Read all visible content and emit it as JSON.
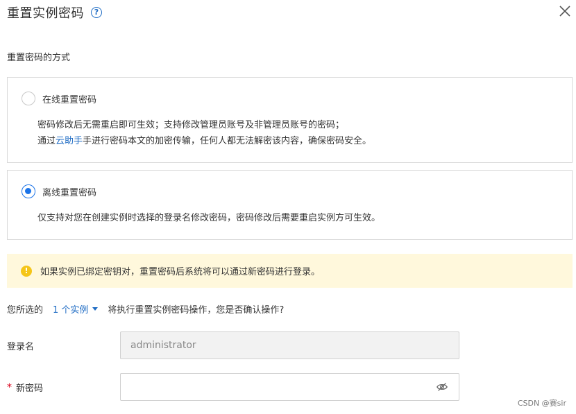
{
  "dialog": {
    "title": "重置实例密码",
    "help_icon": "question-circle-icon",
    "close_icon": "close-icon"
  },
  "method": {
    "section_label": "重置密码的方式",
    "online": {
      "label": "在线重置密码",
      "selected": false,
      "desc_line1": "密码修改后无需重启即可生效；支持修改管理员账号及非管理员账号的密码；",
      "desc_line2_prefix": "通过",
      "desc_line2_link": "云助手",
      "desc_line2_suffix": "手进行密码本文的加密传输，任何人都无法解密该内容，确保密码安全。"
    },
    "offline": {
      "label": "离线重置密码",
      "selected": true,
      "desc": "仅支持对您在创建实例时选择的登录名修改密码，密码修改后需要重启实例方可生效。"
    }
  },
  "notice": {
    "icon": "warning-circle-icon",
    "text": "如果实例已绑定密钥对，重置密码后系统将可以通过新密码进行登录。"
  },
  "confirm": {
    "prefix": "您所选的",
    "instances_dropdown": "1 个实例",
    "suffix": "将执行重置实例密码操作，您是否确认操作?"
  },
  "form": {
    "login_label": "登录名",
    "login_value": "administrator",
    "password_label": "新密码",
    "password_required_mark": "*",
    "password_value": "",
    "password_visibility_icon": "eye-off-icon"
  },
  "watermark": "CSDN @赛sir",
  "colors": {
    "accent": "#1f6cc4",
    "radio_selected": "#1a73e8",
    "notice_bg": "#fff8dc",
    "warning": "#f5c518",
    "required": "#d9001b"
  }
}
